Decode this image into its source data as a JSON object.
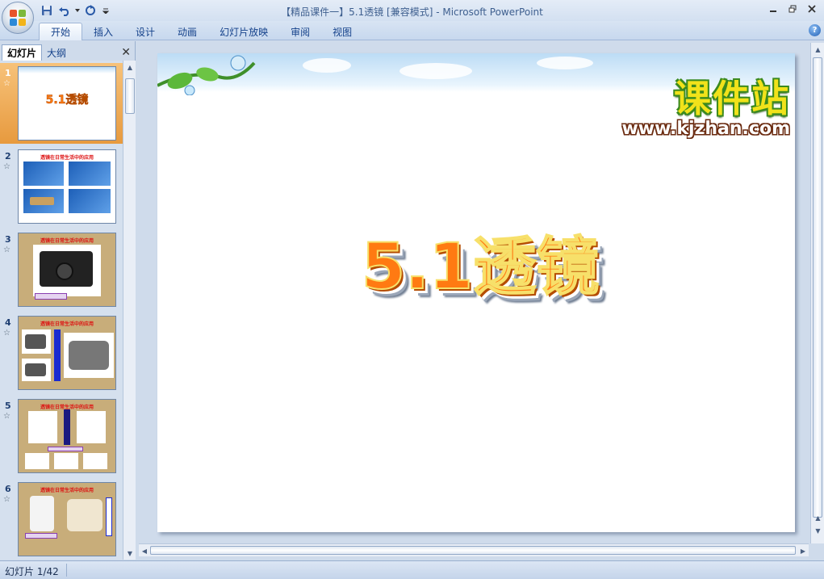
{
  "window": {
    "title": "【精品课件一】5.1透镜 [兼容模式] - Microsoft PowerPoint"
  },
  "ribbon": {
    "tabs": [
      {
        "label": "开始",
        "active": true
      },
      {
        "label": "插入",
        "active": false
      },
      {
        "label": "设计",
        "active": false
      },
      {
        "label": "动画",
        "active": false
      },
      {
        "label": "幻灯片放映",
        "active": false
      },
      {
        "label": "审阅",
        "active": false
      },
      {
        "label": "视图",
        "active": false
      }
    ],
    "help": "?"
  },
  "panel": {
    "tab_slides": "幻灯片",
    "tab_outline": "大纲",
    "close": "✕",
    "thumbnails": [
      {
        "num": "1",
        "selected": true,
        "title": "5.1透镜"
      },
      {
        "num": "2",
        "selected": false,
        "caption": "透镜在日常生活中的应用"
      },
      {
        "num": "3",
        "selected": false,
        "caption": "透镜在日常生活中的应用"
      },
      {
        "num": "4",
        "selected": false,
        "caption": "透镜在日常生活中的应用"
      },
      {
        "num": "5",
        "selected": false,
        "caption": "透镜在日常生活中的应用"
      },
      {
        "num": "6",
        "selected": false,
        "caption": "透镜在日常生活中的应用"
      }
    ],
    "star": "☆"
  },
  "slide": {
    "title": "5.1透镜",
    "brand_cn": "课件站",
    "brand_url": "www.kjzhan.com"
  },
  "status": {
    "slide_info": "幻灯片 1/42"
  },
  "colors": {
    "ribbon_text": "#15428b",
    "selected_thumb": "#e79a3e",
    "title_orange": "#ff7a12"
  }
}
